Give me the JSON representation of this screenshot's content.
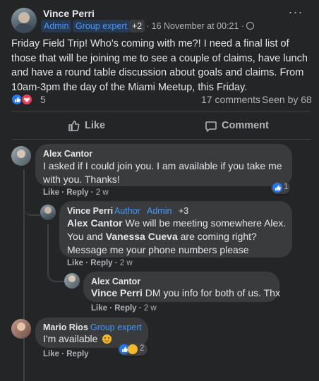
{
  "post": {
    "author": "Vince Perri",
    "badges": [
      "Admin",
      "Group expert"
    ],
    "more_badges": "+2",
    "time": "16 November at 00:21",
    "body": "Friday Field Trip! Who's coming with me?! I need a final list of those that will be joining me to see a couple of claims, have lunch and have a round table discussion about goals and claims. From 10am-3pm the day of the Miami Meetup, this Friday.",
    "reactions_count": "5",
    "comments": "17 comments",
    "seen_by": "Seen by 68",
    "like_label": "Like",
    "comment_label": "Comment"
  },
  "comments": [
    {
      "author": "Alex Cantor",
      "text": "I asked if I could join you. I am available if you take me with you. Thanks!",
      "like": "Like",
      "reply": "Reply",
      "time": "2 w",
      "reactions": "1"
    },
    {
      "author": "Vince Perri",
      "badges": [
        "Author",
        "Admin"
      ],
      "more_badges": "+3",
      "mention1": "Alex Cantor",
      "text1": " We will be meeting somewhere Alex. You and ",
      "mention2": "Vanessa Cueva",
      "text2": " are coming right? Message me your phone numbers please",
      "like": "Like",
      "reply": "Reply",
      "time": "2 w"
    },
    {
      "author": "Alex Cantor",
      "mention": "Vince Perri",
      "text": " DM you info for both of us. Thx",
      "like": "Like",
      "reply": "Reply",
      "time": "2 w"
    },
    {
      "author": "Mario Rios",
      "badge": "Group expert",
      "text": "I'm available",
      "like": "Like",
      "reply": "Reply",
      "reactions": "2"
    }
  ],
  "colors": {
    "background": "#242526",
    "bubble": "#3a3b3c",
    "accent": "#4599ff",
    "like_blue": "#2078f4",
    "love_red": "#f33e58"
  }
}
